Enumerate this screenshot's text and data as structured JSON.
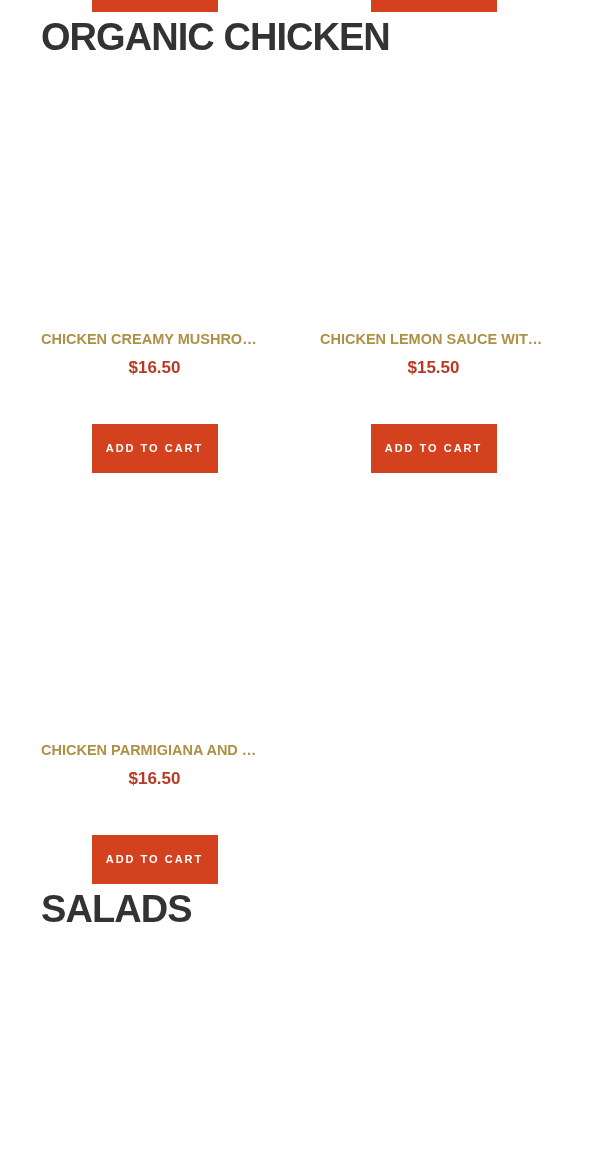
{
  "sections": [
    {
      "heading": "ORGANIC CHICKEN",
      "products": [
        {
          "name": "CHICKEN CREAMY MUSHRO…",
          "price": "$16.50",
          "button": "ADD TO CART"
        },
        {
          "name": "CHICKEN LEMON SAUCE WIT…",
          "price": "$15.50",
          "button": "ADD TO CART"
        },
        {
          "name": "CHICKEN PARMIGIANA AND …",
          "price": "$16.50",
          "button": "ADD TO CART"
        }
      ]
    },
    {
      "heading": "SALADS"
    }
  ]
}
